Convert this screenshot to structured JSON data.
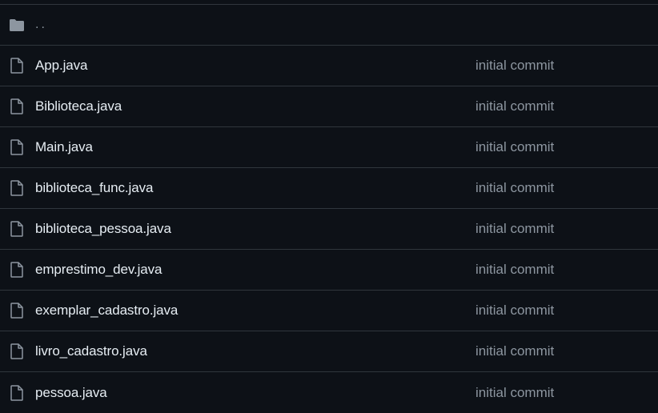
{
  "parent_dir": {
    "icon": "folder-icon",
    "label": ".."
  },
  "files": [
    {
      "icon": "file-icon",
      "name": "App.java",
      "commit": "initial commit"
    },
    {
      "icon": "file-icon",
      "name": "Biblioteca.java",
      "commit": "initial commit"
    },
    {
      "icon": "file-icon",
      "name": "Main.java",
      "commit": "initial commit"
    },
    {
      "icon": "file-icon",
      "name": "biblioteca_func.java",
      "commit": "initial commit"
    },
    {
      "icon": "file-icon",
      "name": "biblioteca_pessoa.java",
      "commit": "initial commit"
    },
    {
      "icon": "file-icon",
      "name": "emprestimo_dev.java",
      "commit": "initial commit"
    },
    {
      "icon": "file-icon",
      "name": "exemplar_cadastro.java",
      "commit": "initial commit"
    },
    {
      "icon": "file-icon",
      "name": "livro_cadastro.java",
      "commit": "initial commit"
    },
    {
      "icon": "file-icon",
      "name": "pessoa.java",
      "commit": "initial commit"
    }
  ],
  "colors": {
    "background": "#0d1117",
    "border": "#30363d",
    "text": "#e6edf3",
    "muted": "#8d96a0"
  }
}
